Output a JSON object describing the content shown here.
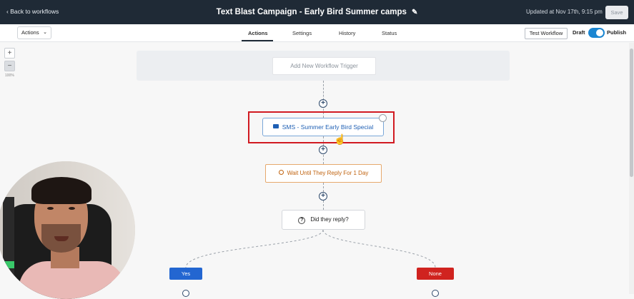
{
  "topbar": {
    "back_label": "Back to workflows",
    "title": "Text Blast Campaign - Early Bird Summer camps",
    "updated": "Updated at Nov 17th, 9:15 pm",
    "save_label": "Save"
  },
  "subbar": {
    "actions_label": "Actions",
    "tabs": [
      {
        "label": "Actions",
        "active": true
      },
      {
        "label": "Settings",
        "active": false
      },
      {
        "label": "History",
        "active": false
      },
      {
        "label": "Status",
        "active": false
      }
    ],
    "test_label": "Test Workflow",
    "draft_label": "Draft",
    "publish_label": "Publish",
    "publish_on": true
  },
  "zoom": {
    "plus": "+",
    "minus": "−",
    "level": "100%"
  },
  "workflow": {
    "trigger_label": "Add New Workflow Trigger",
    "sms_label": "SMS - Summer Early Bird Special",
    "wait_label": "Wait Until They Reply For 1 Day",
    "condition_label": "Did they reply?",
    "branch_yes": "Yes",
    "branch_none": "None"
  },
  "colors": {
    "topbar_bg": "#1f2a36",
    "accent_blue": "#1b86d1",
    "sms_blue": "#1e5fb4",
    "wait_orange": "#c0620e",
    "yes_blue": "#2366d1",
    "none_red": "#d0231f",
    "highlight_red": "#d11a21"
  },
  "icons": {
    "back": "chevron-left-icon",
    "edit": "pencil-icon",
    "sms": "message-icon",
    "wait": "clock-icon",
    "condition": "question-icon",
    "cursor": "hand-pointer-icon"
  }
}
